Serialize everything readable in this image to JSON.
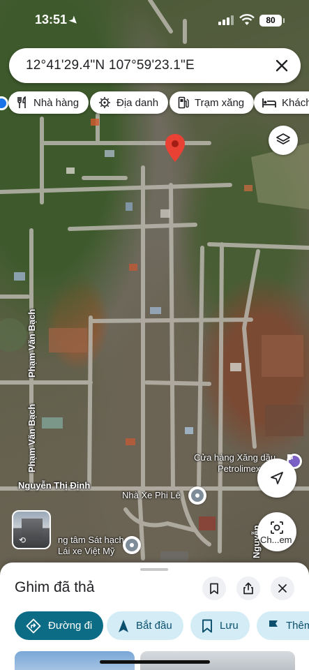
{
  "status_bar": {
    "time": "13:51",
    "battery": "80"
  },
  "search": {
    "query": "12°41'29.4\"N 107°59'23.1\"E"
  },
  "chips": [
    {
      "label": "Nhà hàng",
      "icon": "restaurant-icon"
    },
    {
      "label": "Địa danh",
      "icon": "landmark-icon"
    },
    {
      "label": "Trạm xăng",
      "icon": "gas-station-icon"
    },
    {
      "label": "Khách",
      "icon": "hotel-icon"
    }
  ],
  "map": {
    "roads": {
      "pham_van_bach_1": "Phạm Văn Bạch",
      "pham_van_bach_2": "Phạm Văn Bạch",
      "nguyen_thi_dinh": "Nguyễn Thị Định",
      "nguyen_right": "Nguyễn"
    },
    "pois": {
      "gas_station_line1": "Cửa hàng Xăng dầu",
      "gas_station_line2": "Petrolimex 9",
      "bus": "Nhà Xe Phi Lê",
      "driving_line1": "ng tâm Sát hạch",
      "driving_line2": "Lái xe Việt Mỹ"
    },
    "lens_label": "Ch...em"
  },
  "sheet": {
    "title": "Ghim đã thả",
    "actions": [
      {
        "label": "Đường đi",
        "icon": "directions-icon"
      },
      {
        "label": "Bắt đầu",
        "icon": "navigation-arrow-icon"
      },
      {
        "label": "Lưu",
        "icon": "bookmark-icon"
      },
      {
        "label": "Thêm",
        "icon": "flag-icon"
      }
    ]
  },
  "colors": {
    "accent": "#0d6c85",
    "action_bg": "#d3ecf6",
    "pin_red": "#e94235",
    "my_location_blue": "#1a73e8"
  }
}
